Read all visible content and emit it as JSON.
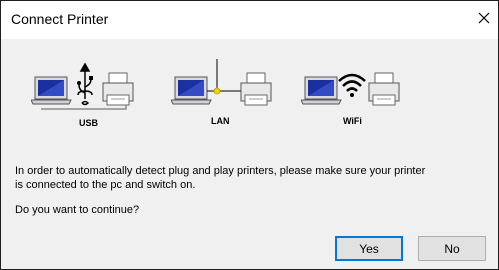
{
  "window": {
    "title": "Connect Printer"
  },
  "devices": [
    {
      "label": "USB",
      "icon": "usb-icon"
    },
    {
      "label": "LAN",
      "icon": "lan-icon"
    },
    {
      "label": "WiFi",
      "icon": "wifi-icon"
    }
  ],
  "message": {
    "line1": "In order to automatically detect plug and play printers, please make sure your printer",
    "line2": "is connected to the pc and switch on.",
    "question": "Do you want to continue?"
  },
  "buttons": {
    "yes": "Yes",
    "no": "No"
  },
  "colors": {
    "focus_border": "#0078d7",
    "laptop_screen": "#1c2f9e",
    "lan_junction": "#f2d200"
  }
}
